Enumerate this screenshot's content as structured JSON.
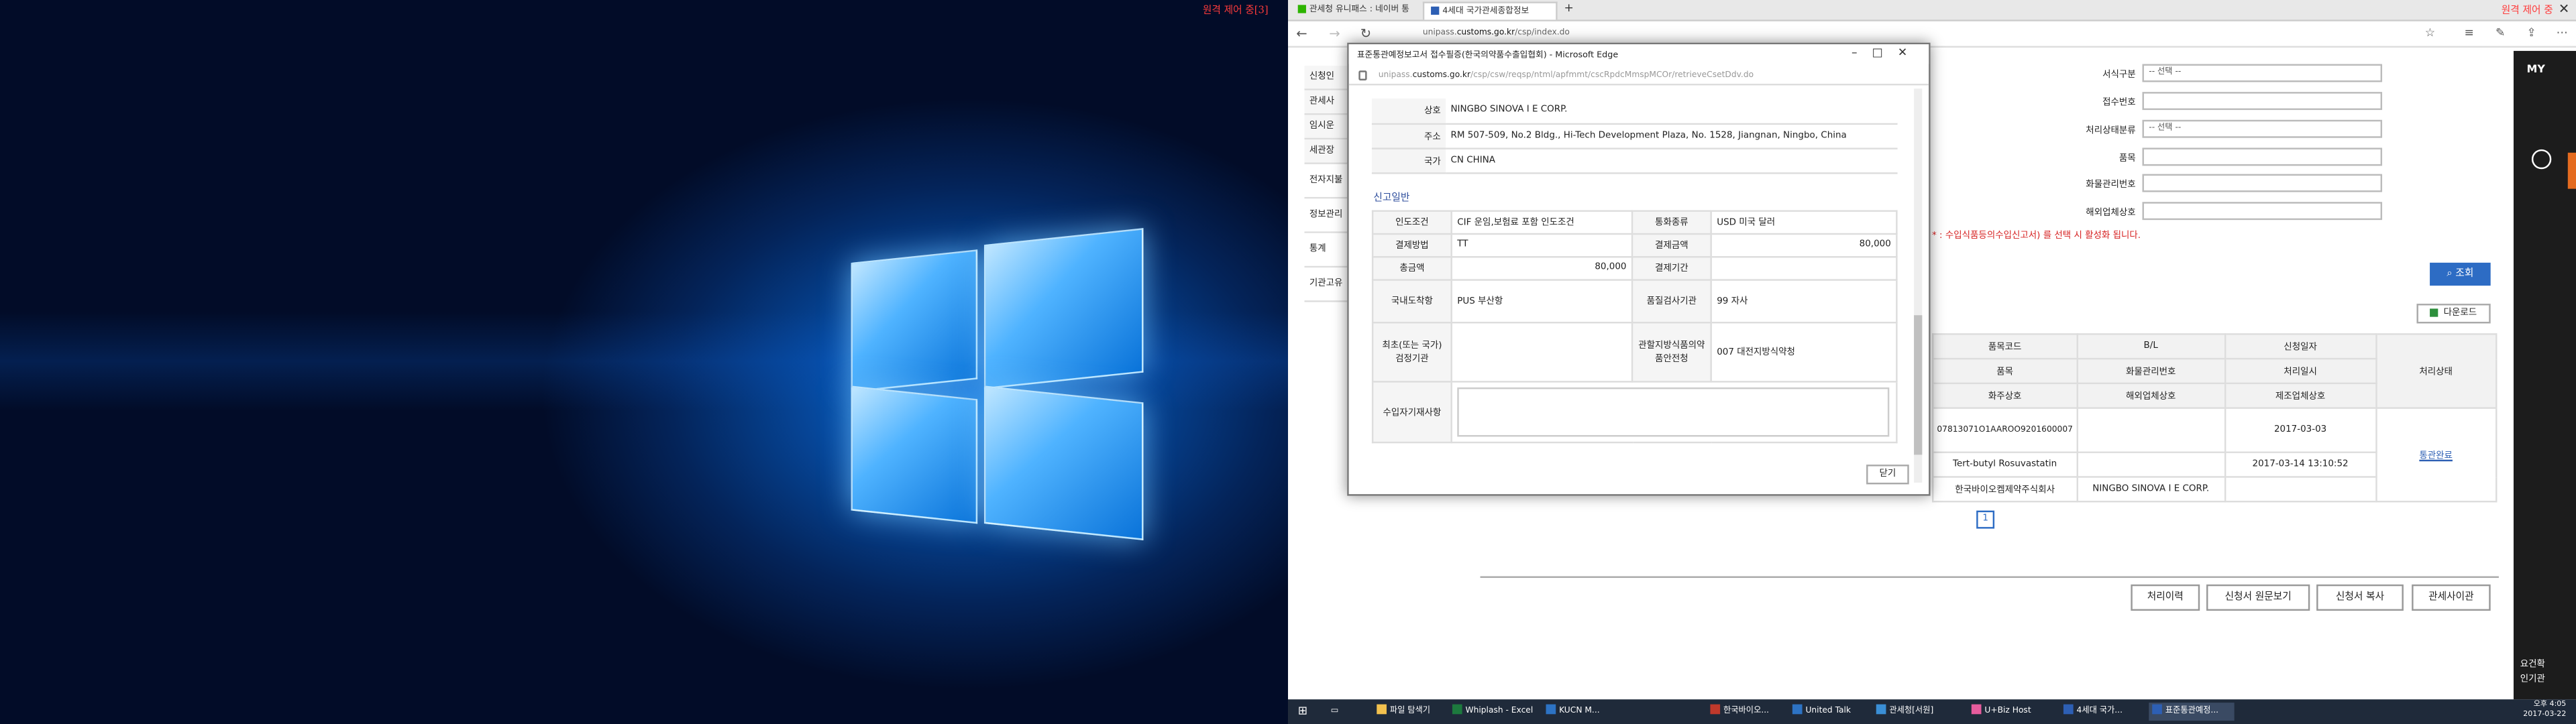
{
  "desktop": {
    "corner_text": "원격 제어 중[3]"
  },
  "browser": {
    "tabs": [
      {
        "label": "관세청 유니패스 : 네이버 통",
        "color": "#2db400"
      },
      {
        "label": "4세대 국가관세종합정보",
        "color": "#2d5fb4"
      }
    ],
    "url_prefix": "unipass.",
    "url_domain": "customs.go.kr",
    "url_path": "/csp/index.do",
    "corner_text": "원격 제어 중"
  },
  "side_menu": [
    "신청인",
    "관세사",
    "임시운",
    "세관장",
    "전자지불",
    "정보관리",
    "통계",
    "기관고유"
  ],
  "search_form": {
    "rows": [
      {
        "label": "서식구분",
        "value": "-- 선택 --"
      },
      {
        "label": "접수번호",
        "value": ""
      },
      {
        "label": "처리상태분류",
        "value": "-- 선택 --"
      },
      {
        "label": "품목",
        "value": ""
      },
      {
        "label": "화물관리번호",
        "value": ""
      },
      {
        "label": "해외업체상호",
        "value": ""
      }
    ],
    "notice": "* : 수입식품등의수입신고서) 를 선택 시 활성화 됩니다.",
    "search_button": "조회",
    "download_button": "다운로드"
  },
  "result_table": {
    "headers": [
      [
        "품목코드",
        "B/L",
        "신청일자",
        "처리상태"
      ],
      [
        "품목",
        "화물관리번호",
        "처리일시"
      ],
      [
        "화주상호",
        "해외업체상호",
        "제조업체상호"
      ]
    ],
    "row": {
      "code": "07813071O1AAROO9201600007",
      "date": "2017-03-03",
      "status": "통관완료",
      "item": "Tert-butyl Rosuvastatin",
      "processed": "2017-03-14 13:10:52",
      "consignee": "한국바이오켐제약주식회사",
      "overseas": "NINGBO SINOVA I E CORP."
    },
    "page": "1"
  },
  "bottom_buttons": [
    "처리이력",
    "신청서 원문보기",
    "신청서 복사",
    "관세사이관"
  ],
  "right_strip": {
    "my": "MY",
    "bottom": [
      "요건확",
      "인기관"
    ]
  },
  "popup": {
    "title": "표준통관예정보고서 접수필증(한국의약품수출입협회) - Microsoft Edge",
    "url_prefix": "unipass.",
    "url_domain": "customs.go.kr",
    "url_path": "/csp/csw/reqsp/ntml/apfmmt/cscRpdcMmspMCOr/retrieveCsetDdv.do",
    "company": [
      {
        "k": "상호",
        "v": "NINGBO SINOVA I E CORP."
      },
      {
        "k": "주소",
        "v": "RM 507-509, No.2 Bldg., Hi-Tech Development Plaza, No. 1528, Jiangnan, Ningbo, China"
      },
      {
        "k": "국가",
        "v": "CN     CHINA"
      }
    ],
    "section_title": "신고일반",
    "general": {
      "incoterms_k": "인도조건",
      "incoterms_v": "CIF     운임,보험료 포함 인도조건",
      "currency_k": "통화종류",
      "currency_v": "USD     미국 달러",
      "pay_method_k": "결제방법",
      "pay_method_v": "TT",
      "pay_amount_k": "결제금액",
      "pay_amount_v": "80,000",
      "total_k": "총금액",
      "total_v": "80,000",
      "pay_period_k": "결제기간",
      "pay_period_v": "",
      "port_k": "국내도착항",
      "port_v": "PUS     부산항",
      "inspect_k": "품질검사기관",
      "inspect_v": "99     자사",
      "first_k": "최초(또는 국가) 검정기관",
      "first_v": "",
      "agency_k": "관할지방식품의약품안전청",
      "agency_v": "007     대전지방식약청",
      "notes_k": "수입자기재사항"
    },
    "close": "닫기"
  },
  "taskbar": {
    "items": [
      "파일 탐색기",
      "Whiplash - Excel",
      "KUCN M...",
      "한국바이오...",
      "United Talk",
      "관세청[서원]",
      "U+Biz Host",
      "4세대 국가...",
      "표준통관예정..."
    ],
    "time": "오후 4:05",
    "date": "2017-03-22"
  }
}
